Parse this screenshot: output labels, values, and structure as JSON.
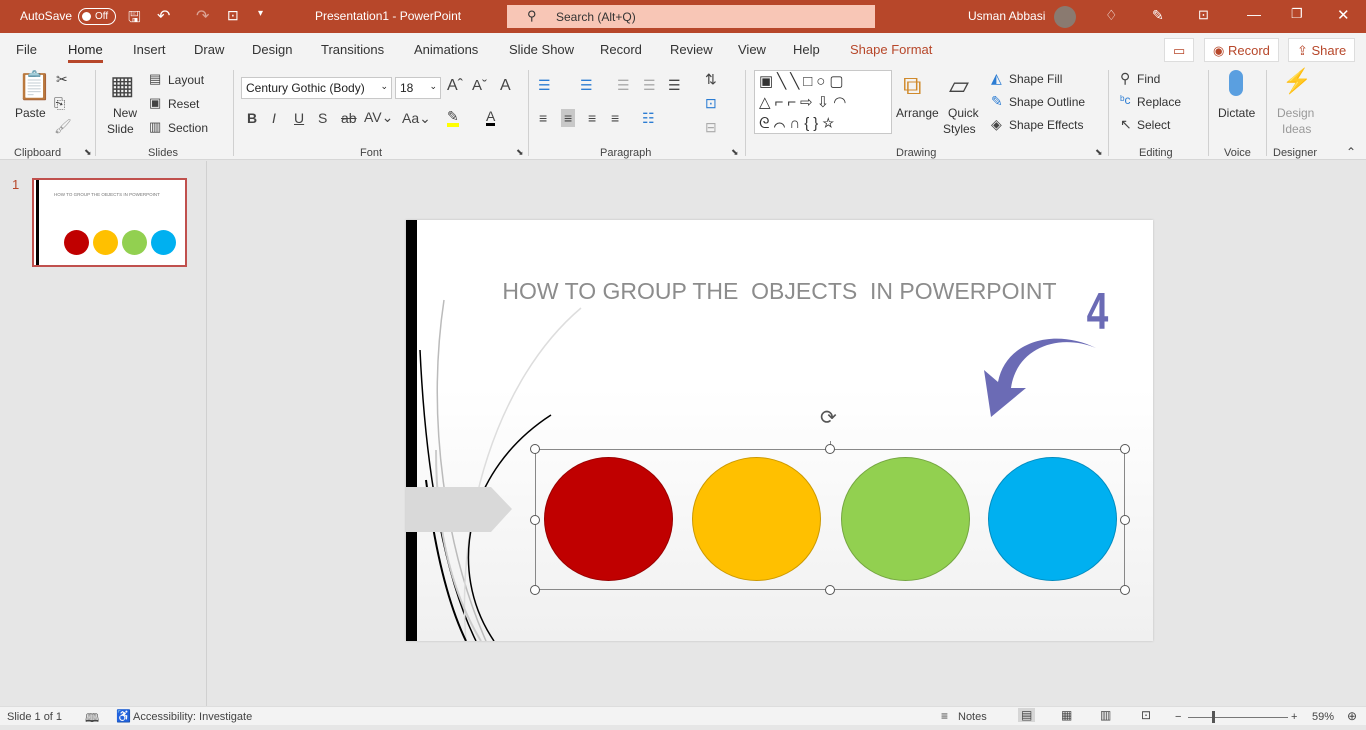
{
  "titlebar": {
    "autosave": "AutoSave",
    "autosave_state": "Off",
    "doc_title": "Presentation1  -  PowerPoint",
    "search_placeholder": "Search (Alt+Q)",
    "user": "Usman Abbasi",
    "accent": "#b7472a"
  },
  "tabs": [
    "File",
    "Home",
    "Insert",
    "Draw",
    "Design",
    "Transitions",
    "Animations",
    "Slide Show",
    "Record",
    "Review",
    "View",
    "Help",
    "Shape Format"
  ],
  "active_tab": "Home",
  "tab_actions": {
    "record": "Record",
    "share": "Share"
  },
  "ribbon": {
    "clipboard": {
      "label": "Clipboard",
      "paste": "Paste"
    },
    "slides": {
      "label": "Slides",
      "new_slide": "New",
      "new_slide2": "Slide",
      "layout": "Layout",
      "reset": "Reset",
      "section": "Section"
    },
    "font": {
      "label": "Font",
      "font_name": "Century Gothic (Body)",
      "font_size": "18"
    },
    "paragraph": {
      "label": "Paragraph"
    },
    "drawing": {
      "label": "Drawing",
      "arrange": "Arrange",
      "quick_styles": "Quick",
      "quick_styles2": "Styles",
      "shape_fill": "Shape Fill",
      "shape_outline": "Shape Outline",
      "shape_effects": "Shape Effects"
    },
    "editing": {
      "label": "Editing",
      "find": "Find",
      "replace": "Replace",
      "select": "Select"
    },
    "voice": {
      "label": "Voice",
      "dictate": "Dictate"
    },
    "designer": {
      "label": "Designer",
      "design_ideas": "Design",
      "design_ideas2": "Ideas"
    }
  },
  "thumbnails": [
    {
      "number": "1",
      "title": "HOW TO GROUP THE  OBJECTS  IN POWERPOINT"
    }
  ],
  "slide": {
    "title": "HOW TO GROUP THE  OBJECTS  IN POWERPOINT",
    "step_number": "4",
    "circles": [
      {
        "color": "#c00000"
      },
      {
        "color": "#ffc000"
      },
      {
        "color": "#92d050"
      },
      {
        "color": "#00b0f0"
      }
    ],
    "arrow_color": "#6b6bb5"
  },
  "status": {
    "slide_count": "Slide 1 of 1",
    "accessibility": "Accessibility: Investigate",
    "notes": "Notes",
    "zoom": "59%"
  }
}
